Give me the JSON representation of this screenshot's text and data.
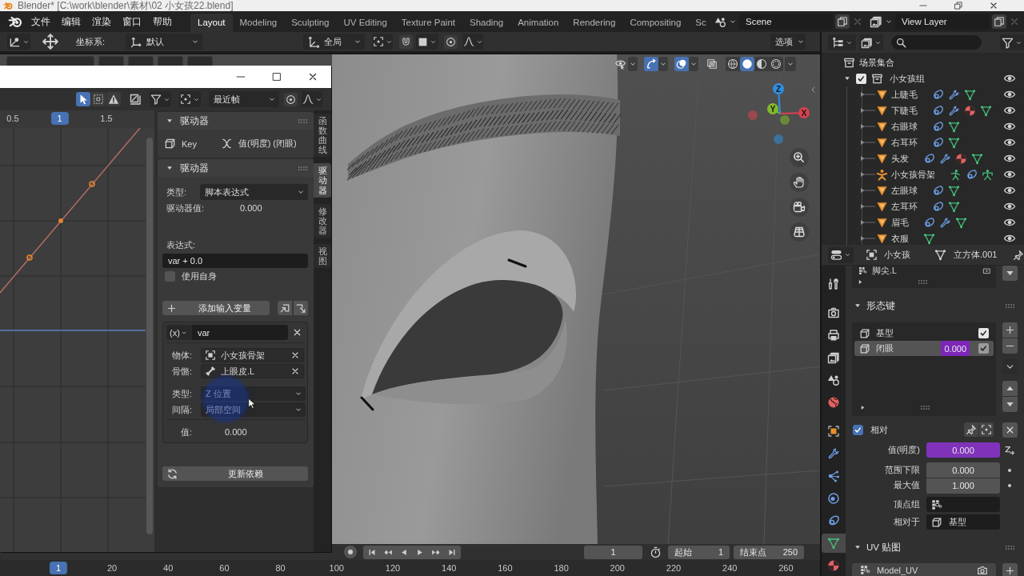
{
  "window": {
    "title": "Blender* [C:\\work\\blender\\素材\\02 小女孩22.blend]"
  },
  "topbar": {
    "menus": [
      "文件",
      "编辑",
      "渲染",
      "窗口",
      "帮助"
    ],
    "workspaces": [
      {
        "label": "Layout",
        "selected": true
      },
      {
        "label": "Modeling",
        "selected": false
      },
      {
        "label": "Sculpting",
        "selected": false
      },
      {
        "label": "UV Editing",
        "selected": false
      },
      {
        "label": "Texture Paint",
        "selected": false
      },
      {
        "label": "Shading",
        "selected": false
      },
      {
        "label": "Animation",
        "selected": false
      },
      {
        "label": "Rendering",
        "selected": false
      },
      {
        "label": "Compositing",
        "selected": false
      },
      {
        "label": "Sc",
        "selected": false
      }
    ],
    "scene": "Scene",
    "view_layer": "View Layer"
  },
  "viewport": {
    "orientation_label": "坐标系:",
    "orientation": "默认",
    "transform_orientation": "全局",
    "options": "选项",
    "toggles": [
      {
        "kind": "visibility",
        "on": false
      },
      {
        "kind": "gizmo",
        "on": true
      },
      {
        "kind": "overlay",
        "on": true
      },
      {
        "kind": "xray",
        "on": false
      }
    ],
    "shading": [
      {
        "kind": "wireframe",
        "selected": false
      },
      {
        "kind": "solid",
        "selected": true
      },
      {
        "kind": "material",
        "selected": false
      },
      {
        "kind": "rendered",
        "selected": false
      }
    ],
    "gizmo_axes": [
      {
        "label": "X",
        "color": "#d8414f"
      },
      {
        "label": "Y",
        "color": "#83b82a"
      },
      {
        "label": "Z",
        "color": "#2f8ee0"
      }
    ]
  },
  "driver_editor": {
    "tools": [
      {
        "kind": "select",
        "selected": true
      },
      {
        "kind": "box_select",
        "selected": false
      },
      {
        "kind": "warning",
        "selected": false
      }
    ],
    "pivot": "最近帧",
    "ruler": [
      {
        "label": "0.5",
        "selected": false
      },
      {
        "label": "1",
        "selected": true
      },
      {
        "label": "1.5",
        "selected": false
      }
    ],
    "tabs": [
      {
        "label": "函数曲线",
        "selected": false
      },
      {
        "label": "驱动器",
        "selected": true
      },
      {
        "label": "修改器",
        "selected": false
      },
      {
        "label": "视图",
        "selected": false
      }
    ],
    "driven_property": {
      "title": "驱动器",
      "expanded": true,
      "id_name": "Key",
      "property": "值(明度) (闭眼)"
    },
    "driver": {
      "title": "驱动器",
      "expanded": true,
      "type_label": "类型:",
      "type": "脚本表达式",
      "value_label": "驱动器值:",
      "value": "0.000",
      "expression_label": "表达式:",
      "expression": "var + 0.0",
      "use_self": {
        "label": "使用自身",
        "checked": false
      },
      "add_variable": "添加输入变量",
      "variables": [
        {
          "symbol": "(x)",
          "name": "var",
          "object_label": "物体:",
          "object": "小女孩骨架",
          "bone_label": "骨骼:",
          "bone": "上眼皮.L",
          "type_label": "类型:",
          "type": "Z 位置",
          "space_label": "间隔:",
          "space": "局部空间",
          "value_label": "值:",
          "value": "0.000"
        }
      ],
      "update": "更新依赖"
    }
  },
  "outliner": {
    "root": "场景集合",
    "collections": [
      {
        "label": "小女孩组",
        "checked": true,
        "expanded": true,
        "visible": true,
        "children": [
          {
            "label": "上睫毛",
            "kind": "mesh",
            "expanded": false,
            "visible": true,
            "data": [
              {
                "kind": "constraint"
              },
              {
                "kind": "modifier"
              },
              {
                "kind": "mesh_data"
              }
            ]
          },
          {
            "label": "下睫毛",
            "kind": "mesh",
            "expanded": false,
            "visible": true,
            "data": [
              {
                "kind": "constraint"
              },
              {
                "kind": "modifier"
              },
              {
                "kind": "material"
              },
              {
                "kind": "mesh_data"
              }
            ]
          },
          {
            "label": "右眼球",
            "kind": "mesh",
            "expanded": false,
            "visible": true,
            "data": [
              {
                "kind": "constraint"
              },
              {
                "kind": "mesh_data"
              }
            ]
          },
          {
            "label": "右耳环",
            "kind": "mesh",
            "expanded": false,
            "visible": true,
            "data": [
              {
                "kind": "constraint"
              },
              {
                "kind": "mesh_data"
              }
            ]
          },
          {
            "label": "头发",
            "kind": "mesh",
            "expanded": false,
            "visible": true,
            "data": [
              {
                "kind": "constraint"
              },
              {
                "kind": "modifier"
              },
              {
                "kind": "material"
              },
              {
                "kind": "mesh_data"
              }
            ]
          },
          {
            "label": "小女孩骨架",
            "kind": "armature",
            "expanded": false,
            "visible": true,
            "data": [
              {
                "kind": "pose"
              },
              {
                "kind": "constraint"
              },
              {
                "kind": "armature_data"
              }
            ]
          },
          {
            "label": "左眼球",
            "kind": "mesh",
            "expanded": false,
            "visible": true,
            "data": [
              {
                "kind": "constraint"
              },
              {
                "kind": "mesh_data"
              }
            ]
          },
          {
            "label": "左耳环",
            "kind": "mesh",
            "expanded": false,
            "visible": true,
            "data": [
              {
                "kind": "constraint"
              },
              {
                "kind": "mesh_data"
              }
            ]
          },
          {
            "label": "眉毛",
            "kind": "mesh",
            "expanded": false,
            "visible": true,
            "data": [
              {
                "kind": "constraint"
              },
              {
                "kind": "modifier"
              },
              {
                "kind": "mesh_data"
              }
            ]
          },
          {
            "label": "衣服",
            "kind": "mesh",
            "expanded": false,
            "visible": true,
            "data": [
              {
                "kind": "mesh_data"
              }
            ]
          }
        ]
      }
    ]
  },
  "properties": {
    "object": "小女孩",
    "data": "立方体.001",
    "tabs": [
      {
        "kind": "tool",
        "selected": false
      },
      {
        "kind": "render",
        "selected": false
      },
      {
        "kind": "output",
        "selected": false
      },
      {
        "kind": "view_layer",
        "selected": false
      },
      {
        "kind": "scene",
        "selected": false
      },
      {
        "kind": "world",
        "selected": false
      },
      {
        "kind": "object",
        "selected": false
      },
      {
        "kind": "modifier",
        "selected": false
      },
      {
        "kind": "particles",
        "selected": false
      },
      {
        "kind": "physics",
        "selected": false
      },
      {
        "kind": "constraint",
        "selected": false
      },
      {
        "kind": "data",
        "selected": true
      },
      {
        "kind": "material",
        "selected": false
      }
    ],
    "vertex_group": "脚尖.L",
    "shape_keys": {
      "title": "形态键",
      "expanded": true,
      "keys": [
        {
          "name": "基型",
          "selected": false,
          "checked": true
        },
        {
          "name": "闭眼",
          "value": "0.000",
          "driven": true,
          "selected": true,
          "checked": true
        }
      ],
      "relative": {
        "label": "相对",
        "checked": true
      },
      "fields": [
        {
          "kind": "slider",
          "label": "值(明度)",
          "value": "0.000",
          "driven": true
        },
        {
          "kind": "number",
          "label": "范围下限",
          "value": "0.000",
          "driven": false
        },
        {
          "kind": "number",
          "label": "最大值",
          "value": "1.000",
          "driven": false
        },
        {
          "kind": "vertex_group",
          "label": "顶点组"
        },
        {
          "kind": "shape_key",
          "label": "相对于",
          "value": "基型"
        }
      ]
    },
    "uv_maps": {
      "title": "UV 贴图",
      "expanded": true,
      "items": [
        "Model_UV"
      ]
    }
  },
  "timeline": {
    "current_frame": "1",
    "start_label": "起始",
    "start": "1",
    "end_label": "结束点",
    "end": "250",
    "ruler": [
      {
        "label": "1",
        "selected": true
      },
      {
        "label": "20",
        "selected": false
      },
      {
        "label": "40",
        "selected": false
      },
      {
        "label": "60",
        "selected": false
      },
      {
        "label": "80",
        "selected": false
      },
      {
        "label": "100",
        "selected": false
      },
      {
        "label": "120",
        "selected": false
      },
      {
        "label": "140",
        "selected": false
      },
      {
        "label": "160",
        "selected": false
      },
      {
        "label": "180",
        "selected": false
      },
      {
        "label": "200",
        "selected": false
      },
      {
        "label": "220",
        "selected": false
      },
      {
        "label": "240",
        "selected": false
      },
      {
        "label": "260",
        "selected": false
      }
    ]
  }
}
